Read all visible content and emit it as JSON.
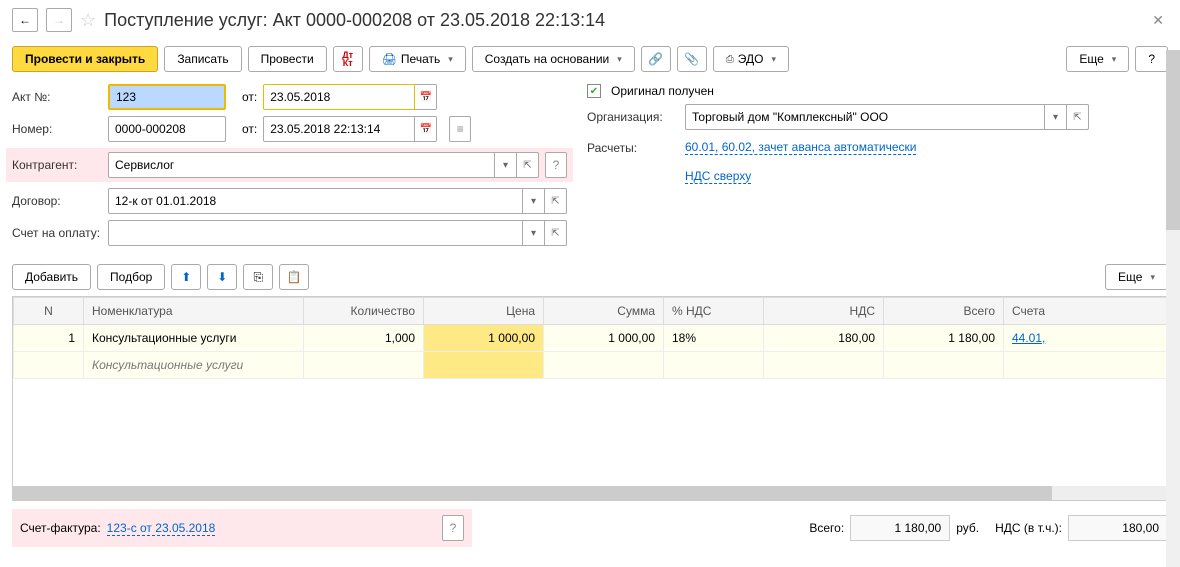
{
  "header": {
    "title": "Поступление услуг: Акт 0000-000208 от 23.05.2018 22:13:14"
  },
  "toolbar": {
    "post_close": "Провести и закрыть",
    "write": "Записать",
    "post": "Провести",
    "print": "Печать",
    "create_based": "Создать на основании",
    "edo": "ЭДО",
    "more": "Еще",
    "help": "?"
  },
  "form": {
    "act_no_label": "Акт №:",
    "act_no": "123",
    "from_label": "от:",
    "act_date": "23.05.2018",
    "original_received": "Оригинал получен",
    "number_label": "Номер:",
    "number": "0000-000208",
    "number_date": "23.05.2018 22:13:14",
    "org_label": "Организация:",
    "org": "Торговый дом \"Комплексный\" ООО",
    "counterparty_label": "Контрагент:",
    "counterparty": "Сервислог",
    "settlements_label": "Расчеты:",
    "settlements": "60.01, 60.02, зачет аванса автоматически",
    "contract_label": "Договор:",
    "contract": "12-к от 01.01.2018",
    "vat_link": "НДС сверху",
    "invoice_label": "Счет на оплату:"
  },
  "table_toolbar": {
    "add": "Добавить",
    "select": "Подбор",
    "more": "Еще"
  },
  "table": {
    "headers": [
      "N",
      "Номенклатура",
      "Количество",
      "Цена",
      "Сумма",
      "% НДС",
      "НДС",
      "Всего",
      "Счета"
    ],
    "rows": [
      {
        "n": "1",
        "nomenclature": "Консультационные услуги",
        "nomenclature_sub": "Консультационные услуги",
        "qty": "1,000",
        "price": "1 000,00",
        "sum": "1 000,00",
        "vat_pct": "18%",
        "vat": "180,00",
        "total": "1 180,00",
        "account": "44.01,"
      }
    ]
  },
  "footer": {
    "invoice_factura_label": "Счет-фактура:",
    "invoice_factura": "123-с от 23.05.2018",
    "total_label": "Всего:",
    "total": "1 180,00",
    "currency": "руб.",
    "vat_label": "НДС (в т.ч.):",
    "vat": "180,00"
  }
}
